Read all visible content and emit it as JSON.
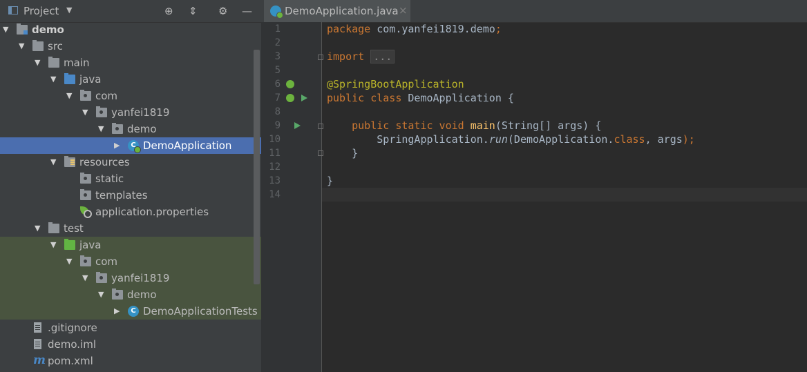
{
  "project_panel": {
    "title": "Project",
    "tree": [
      {
        "label": "demo",
        "indent": 0,
        "arrow": "down",
        "icon": "module-folder",
        "bold": true
      },
      {
        "label": "src",
        "indent": 1,
        "arrow": "down",
        "icon": "folder"
      },
      {
        "label": "main",
        "indent": 2,
        "arrow": "down",
        "icon": "folder"
      },
      {
        "label": "java",
        "indent": 3,
        "arrow": "down",
        "icon": "source-folder"
      },
      {
        "label": "com",
        "indent": 4,
        "arrow": "down",
        "icon": "package"
      },
      {
        "label": "yanfei1819",
        "indent": 5,
        "arrow": "down",
        "icon": "package"
      },
      {
        "label": "demo",
        "indent": 6,
        "arrow": "down",
        "icon": "package"
      },
      {
        "label": "DemoApplication",
        "indent": 7,
        "arrow": "right",
        "icon": "spring-class",
        "selected": true
      },
      {
        "label": "resources",
        "indent": 3,
        "arrow": "down",
        "icon": "resources-folder"
      },
      {
        "label": "static",
        "indent": 4,
        "arrow": "",
        "icon": "package"
      },
      {
        "label": "templates",
        "indent": 4,
        "arrow": "",
        "icon": "package"
      },
      {
        "label": "application.properties",
        "indent": 4,
        "arrow": "",
        "icon": "spring-properties"
      },
      {
        "label": "test",
        "indent": 2,
        "arrow": "down",
        "icon": "folder"
      },
      {
        "label": "java",
        "indent": 3,
        "arrow": "down",
        "icon": "test-folder",
        "test": true
      },
      {
        "label": "com",
        "indent": 4,
        "arrow": "down",
        "icon": "package",
        "test": true
      },
      {
        "label": "yanfei1819",
        "indent": 5,
        "arrow": "down",
        "icon": "package",
        "test": true
      },
      {
        "label": "demo",
        "indent": 6,
        "arrow": "down",
        "icon": "package",
        "test": true
      },
      {
        "label": "DemoApplicationTests",
        "indent": 7,
        "arrow": "right",
        "icon": "class",
        "test": true
      },
      {
        "label": ".gitignore",
        "indent": 1,
        "arrow": "",
        "icon": "file"
      },
      {
        "label": "demo.iml",
        "indent": 1,
        "arrow": "",
        "icon": "file"
      },
      {
        "label": "pom.xml",
        "indent": 1,
        "arrow": "",
        "icon": "maven"
      }
    ]
  },
  "editor": {
    "tab_label": "DemoApplication.java",
    "tab_close": "×",
    "current_line": 14,
    "lines": [
      {
        "n": "1",
        "tokens": [
          {
            "t": "package ",
            "c": "kw"
          },
          {
            "t": "com.yanfei1819.demo"
          },
          {
            "t": ";",
            "c": "kw"
          }
        ]
      },
      {
        "n": "2",
        "tokens": []
      },
      {
        "n": "3",
        "tokens": [
          {
            "t": "import ",
            "c": "kw"
          },
          {
            "t": "...",
            "c": "fold"
          }
        ]
      },
      {
        "n": "5",
        "tokens": []
      },
      {
        "n": "6",
        "tokens": [
          {
            "t": "@SpringBootApplication",
            "c": "ann"
          }
        ]
      },
      {
        "n": "7",
        "tokens": [
          {
            "t": "public class ",
            "c": "kw"
          },
          {
            "t": "DemoApplication {"
          }
        ]
      },
      {
        "n": "8",
        "tokens": []
      },
      {
        "n": "9",
        "tokens": [
          {
            "t": "    "
          },
          {
            "t": "public static void ",
            "c": "kw"
          },
          {
            "t": "main",
            "c": "fn"
          },
          {
            "t": "(String[] args) {"
          }
        ]
      },
      {
        "n": "10",
        "tokens": [
          {
            "t": "        SpringApplication."
          },
          {
            "t": "run",
            "c": "it"
          },
          {
            "t": "(DemoApplication."
          },
          {
            "t": "class",
            "c": "kw"
          },
          {
            "t": ", "
          },
          {
            "t": "args"
          },
          {
            "t": ");",
            "c": "kw"
          }
        ]
      },
      {
        "n": "11",
        "tokens": [
          {
            "t": "    }"
          }
        ]
      },
      {
        "n": "12",
        "tokens": []
      },
      {
        "n": "13",
        "tokens": [
          {
            "t": "}"
          }
        ]
      },
      {
        "n": "14",
        "tokens": []
      }
    ]
  },
  "colors": {
    "panel_bg": "#3c3f41",
    "editor_bg": "#2b2b2b",
    "selection": "#4b6eaf",
    "test_bg": "#49543f",
    "keyword": "#cc7832",
    "annotation": "#bbb529",
    "method": "#ffc66d",
    "text": "#a9b7c6"
  }
}
